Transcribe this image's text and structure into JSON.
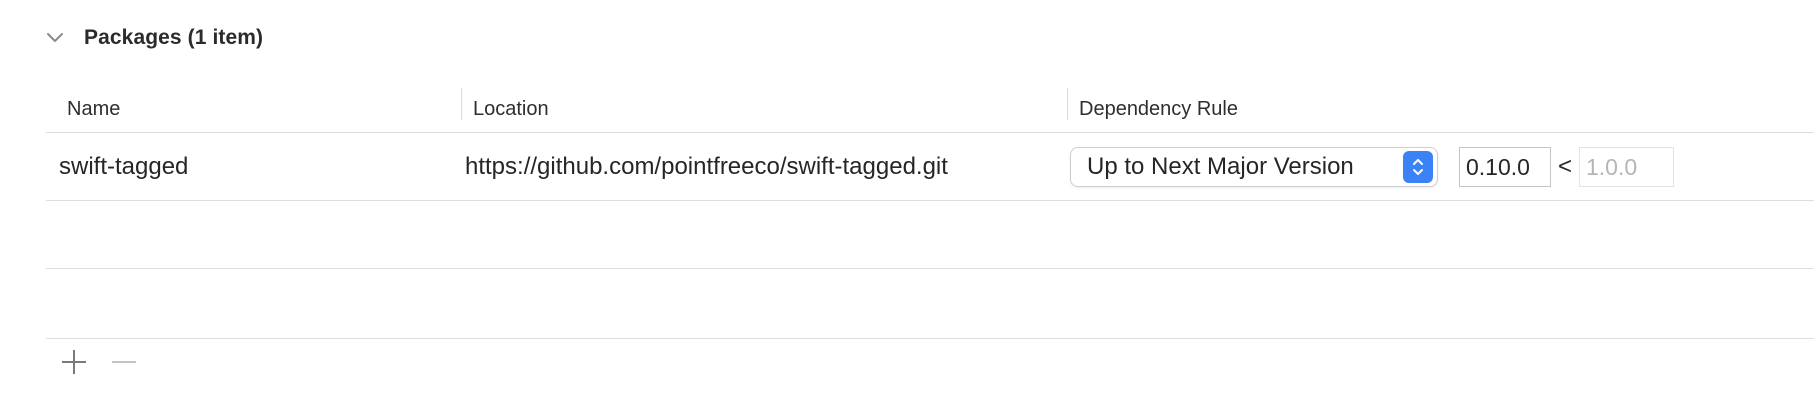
{
  "section": {
    "title": "Packages (1 item)",
    "chevron_icon": "chevron-down-icon"
  },
  "table": {
    "columns": [
      "Name",
      "Location",
      "Dependency Rule"
    ],
    "rows": [
      {
        "name": "swift-tagged",
        "location": "https://github.com/pointfreeco/swift-tagged.git",
        "rule": "Up to Next Major Version",
        "version_min": "0.10.0",
        "separator": "<",
        "version_max": "1.0.0"
      }
    ]
  },
  "footer": {
    "add_icon": "plus-icon",
    "remove_icon": "minus-icon"
  },
  "colors": {
    "accent": "#3b82f6",
    "placeholder": "#b5b5b5",
    "separator": "#dcdcdc"
  }
}
